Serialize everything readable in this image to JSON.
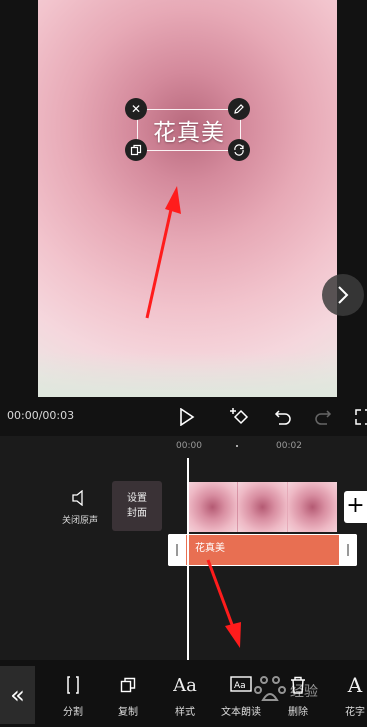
{
  "preview": {
    "overlay_text": "花真美"
  },
  "playback": {
    "time": "00:00/00:03"
  },
  "timeline": {
    "ruler": [
      "00:00",
      "00:02"
    ],
    "mute_label": "关闭原声",
    "cover_line1": "设置",
    "cover_line2": "封面",
    "text_clip_label": "花真美",
    "add_symbol": "+"
  },
  "toolbar": {
    "items": [
      {
        "label": "分割"
      },
      {
        "label": "复制"
      },
      {
        "label": "样式"
      },
      {
        "label": "文本朗读"
      },
      {
        "label": "删除"
      },
      {
        "label": "花字"
      }
    ]
  },
  "colors": {
    "background": "#121212",
    "text_clip": "#e86f52",
    "annotation_arrow": "#ff1c1c"
  }
}
